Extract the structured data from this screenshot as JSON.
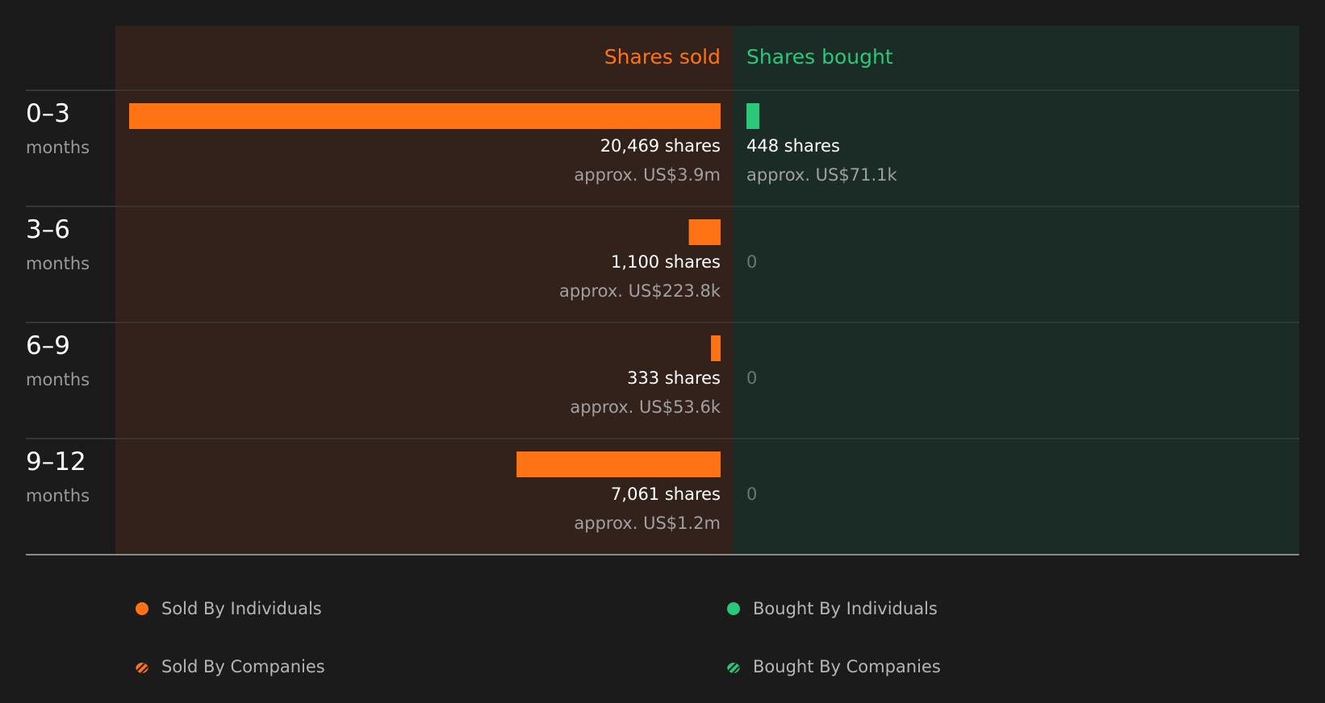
{
  "colors": {
    "sold": "#ff7314",
    "bought": "#2ac879",
    "sold_panel_bg": "#33221b",
    "bought_panel_bg": "#1b2b25",
    "page_bg": "#1b1b1b",
    "zero_text": "#647a70",
    "approx_text": "#a0a0a0",
    "period_unit_text": "#9a9a9a",
    "legend_text": "#b5b5b5"
  },
  "chart_data": {
    "type": "bar",
    "orientation": "horizontal-diverging",
    "grid": "row separators",
    "headers": {
      "sold": "Shares sold",
      "bought": "Shares bought"
    },
    "categories": [
      {
        "period": "0–3",
        "unit": "months"
      },
      {
        "period": "3–6",
        "unit": "months"
      },
      {
        "period": "6–9",
        "unit": "months"
      },
      {
        "period": "9–12",
        "unit": "months"
      }
    ],
    "series": [
      {
        "name": "Shares sold",
        "side": "left",
        "values": [
          20469,
          1100,
          333,
          7061
        ],
        "labels": [
          "20,469 shares",
          "1,100 shares",
          "333 shares",
          "7,061 shares"
        ],
        "approx": [
          "approx. US$3.9m",
          "approx. US$223.8k",
          "approx. US$53.6k",
          "approx. US$1.2m"
        ]
      },
      {
        "name": "Shares bought",
        "side": "right",
        "values": [
          448,
          0,
          0,
          0
        ],
        "labels": [
          "448 shares",
          "0",
          "0",
          "0"
        ],
        "approx": [
          "approx. US$71.1k",
          "",
          "",
          ""
        ]
      }
    ],
    "scale_max": 20469
  },
  "legend": {
    "sold_individuals": "Sold By Individuals",
    "bought_individuals": "Bought By Individuals",
    "sold_companies": "Sold By Companies",
    "bought_companies": "Bought By Companies"
  }
}
